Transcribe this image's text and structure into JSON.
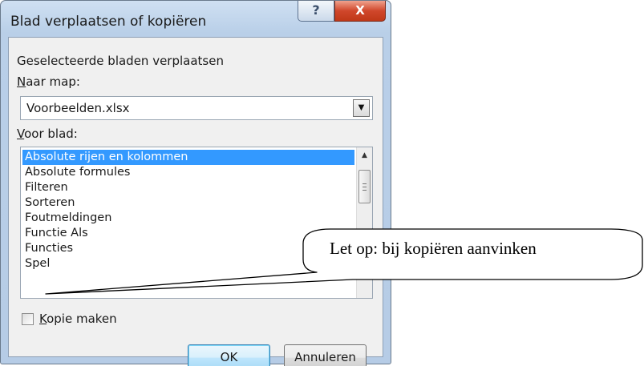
{
  "document": {
    "heading_regular_1": "",
    "heading_bold": "",
    "heading_regular_2": ""
  },
  "dialog": {
    "title": "Blad verplaatsen of kopiëren",
    "help_glyph": "?",
    "close_glyph": "X",
    "move_selected_label": "Geselecteerde bladen verplaatsen",
    "to_book": {
      "label_accel": "N",
      "label_rest": "aar map:",
      "value": "Voorbeelden.xlsx",
      "dropdown_icon": "chevron-down-icon"
    },
    "before_sheet": {
      "label_accel": "V",
      "label_rest": "oor blad:",
      "items": [
        "Absolute rijen en kolommen",
        "Absolute formules",
        "Filteren",
        "Sorteren",
        "Foutmeldingen",
        "Functie Als",
        "Functies",
        "Spel"
      ],
      "selected_index": 0
    },
    "copy_checkbox": {
      "label_accel": "K",
      "label_rest": "opie maken",
      "checked": false
    },
    "buttons": {
      "ok": "OK",
      "cancel": "Annuleren"
    }
  },
  "callout": {
    "text": "Let op: bij kopiëren aanvinken"
  },
  "colors": {
    "selection": "#3399ff",
    "close_button": "#c8432a",
    "title_bar": "#c3d6ec"
  }
}
